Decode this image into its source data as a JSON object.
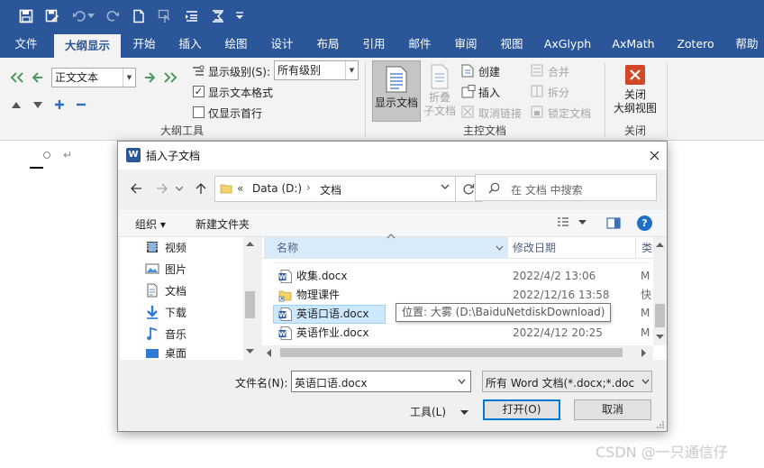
{
  "colors": {
    "word_blue": "#2b579a",
    "ribbon_bg": "#f3f3f3",
    "dialog_bg": "#f0f0f0",
    "selection": "#cce8ff",
    "accent": "#0078d7",
    "close_red": "#d24726"
  },
  "qat": {
    "icons": [
      "save-icon",
      "save-as-icon",
      "undo-icon",
      "redo-icon",
      "new-doc-icon",
      "touch-mode-icon",
      "promote-icon",
      "outline-level-icon",
      "more-icon"
    ]
  },
  "tabs": [
    {
      "label": "文件",
      "active": false
    },
    {
      "label": "大纲显示",
      "active": true
    },
    {
      "label": "开始",
      "active": false
    },
    {
      "label": "插入",
      "active": false
    },
    {
      "label": "绘图",
      "active": false
    },
    {
      "label": "设计",
      "active": false
    },
    {
      "label": "布局",
      "active": false
    },
    {
      "label": "引用",
      "active": false
    },
    {
      "label": "邮件",
      "active": false
    },
    {
      "label": "审阅",
      "active": false
    },
    {
      "label": "视图",
      "active": false
    },
    {
      "label": "AxGlyph",
      "active": false
    },
    {
      "label": "AxMath",
      "active": false
    },
    {
      "label": "Zotero",
      "active": false
    },
    {
      "label": "帮助",
      "active": false
    }
  ],
  "ribbon": {
    "outline_tools": {
      "group_label": "大纲工具",
      "level_value": "正文文本",
      "show_level_label": "显示级别(S):",
      "show_level_value": "所有级别",
      "show_text_format": "显示文本格式",
      "show_text_format_checked": true,
      "first_line_only": "仅显示首行",
      "first_line_only_checked": false
    },
    "master_document": {
      "group_label": "主控文档",
      "show_document": "显示文档",
      "collapse_line1": "折叠",
      "collapse_line2": "子文档",
      "create": "创建",
      "insert": "插入",
      "unlink": "取消链接",
      "merge": "合并",
      "split": "拆分",
      "lock": "锁定文档"
    },
    "close": {
      "group_label": "关闭",
      "close_line1": "关闭",
      "close_line2": "大纲视图"
    }
  },
  "dialog": {
    "title": "插入子文档",
    "address": {
      "prefix": "«",
      "segments": [
        "Data (D:)",
        "文档"
      ]
    },
    "search_placeholder": "在 文档 中搜索",
    "organize": "组织 ▾",
    "new_folder": "新建文件夹",
    "nav_items": [
      "视频",
      "图片",
      "文档",
      "下载",
      "音乐",
      "桌面"
    ],
    "columns": {
      "name": "名称",
      "date": "修改日期",
      "type": "类"
    },
    "files": [
      {
        "name": "收集.docx",
        "date": "2022/4/2 13:06",
        "type": "M",
        "kind": "word",
        "selected": false
      },
      {
        "name": "物理课件",
        "date": "2022/12/16 13:58",
        "type": "快",
        "kind": "folder",
        "selected": false
      },
      {
        "name": "英语口语.docx",
        "date": "",
        "type": "M",
        "kind": "word",
        "selected": true
      },
      {
        "name": "英语作业.docx",
        "date": "2022/4/12 20:25",
        "type": "M",
        "kind": "word",
        "selected": false
      }
    ],
    "tooltip": "位置: 大雾 (D:\\BaiduNetdiskDownload)",
    "filename_label": "文件名(N):",
    "filename_value": "英语口语.docx",
    "filetype_value": "所有 Word 文档(*.docx;*.doc",
    "tools": "工具(L)",
    "open": "打开(O)",
    "cancel": "取消"
  },
  "watermark": "CSDN @一只通信仔"
}
